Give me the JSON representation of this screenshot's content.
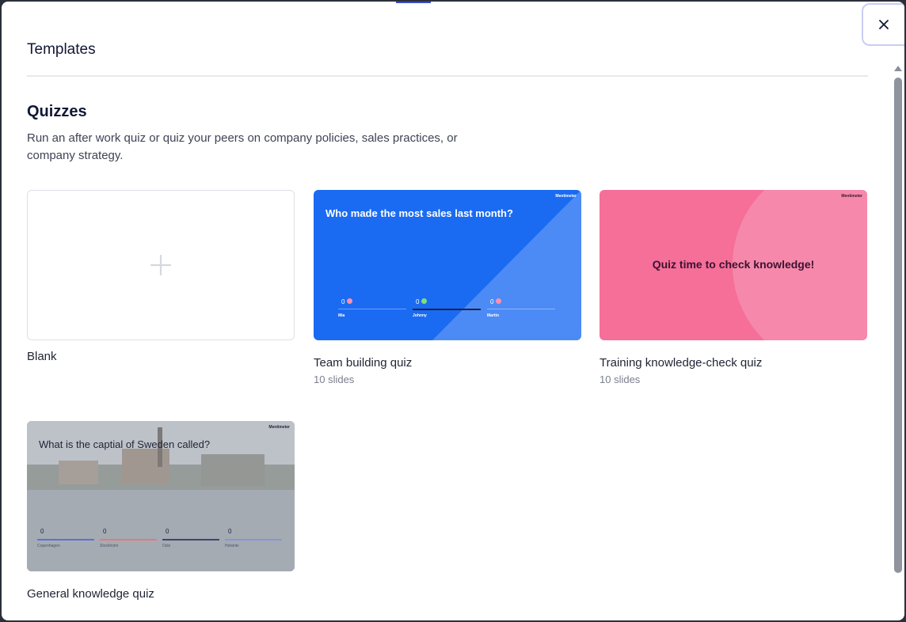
{
  "modal": {
    "title": "Templates",
    "close_icon": "close-icon"
  },
  "section": {
    "title": "Quizzes",
    "description": "Run an after work quiz or quiz your peers on company policies, sales practices, or company strategy."
  },
  "templates": [
    {
      "name": "Blank",
      "icon": "plus-icon"
    },
    {
      "name": "Team building quiz",
      "meta": "10 slides",
      "slide_question": "Who made the most sales last month?",
      "logo": "Mentimeter",
      "bar_values": [
        {
          "value": "0",
          "name": "Mia",
          "emoji": "pink"
        },
        {
          "value": "0",
          "name": "Johnny",
          "emoji": "green"
        },
        {
          "value": "0",
          "name": "Martin",
          "emoji": "pink"
        }
      ]
    },
    {
      "name": "Training knowledge-check quiz",
      "meta": "10 slides",
      "slide_question": "Quiz time to check knowledge!",
      "logo": "Mentimeter"
    },
    {
      "name": "General knowledge quiz",
      "slide_question": "What is the captial of Sweden called?",
      "logo": "Mentimeter",
      "bar_values": [
        {
          "value": "0",
          "name": "Copenhagen"
        },
        {
          "value": "0",
          "name": "Stockholm"
        },
        {
          "value": "0",
          "name": "Oslo"
        },
        {
          "value": "0",
          "name": "Helsinki"
        }
      ]
    }
  ],
  "colors": {
    "accent": "#3d4cc4",
    "blue_slide": "#1a6bf2",
    "pink_slide": "#f56f99",
    "text_primary": "#101834"
  }
}
